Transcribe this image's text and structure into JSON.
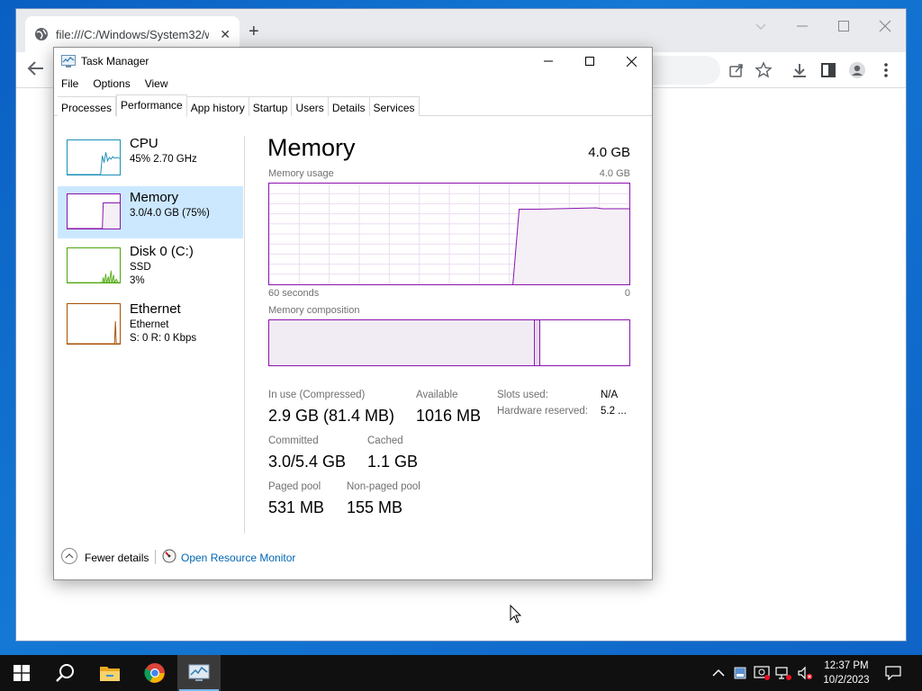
{
  "browser": {
    "tab_title": "file:///C:/Windows/System32/w",
    "new_tab": "+",
    "close_glyph": "✕"
  },
  "task_manager": {
    "title": "Task Manager",
    "menu": [
      "File",
      "Options",
      "View"
    ],
    "tabs": [
      "Processes",
      "Performance",
      "App history",
      "Startup",
      "Users",
      "Details",
      "Services"
    ],
    "active_tab": "Performance",
    "resources": [
      {
        "name": "CPU",
        "line1": "45%  2.70 GHz",
        "line2": "",
        "color": "#1a8fb8"
      },
      {
        "name": "Memory",
        "line1": "3.0/4.0 GB (75%)",
        "line2": "",
        "color": "#8b12ae",
        "selected": true
      },
      {
        "name": "Disk 0 (C:)",
        "line1": "SSD",
        "line2": "3%",
        "color": "#4da60c"
      },
      {
        "name": "Ethernet",
        "line1": "Ethernet",
        "line2": "S: 0  R: 0 Kbps",
        "color": "#a74f01"
      }
    ],
    "memory": {
      "title": "Memory",
      "total": "4.0 GB",
      "usage_label": "Memory usage",
      "usage_max": "4.0 GB",
      "axis_left": "60 seconds",
      "axis_right": "0",
      "composition_label": "Memory composition",
      "stats": {
        "in_use_label": "In use (Compressed)",
        "in_use_value": "2.9 GB (81.4 MB)",
        "available_label": "Available",
        "available_value": "1016 MB",
        "committed_label": "Committed",
        "committed_value": "3.0/5.4 GB",
        "cached_label": "Cached",
        "cached_value": "1.1 GB",
        "paged_label": "Paged pool",
        "paged_value": "531 MB",
        "nonpaged_label": "Non-paged pool",
        "nonpaged_value": "155 MB",
        "slots_label": "Slots used:",
        "slots_value": "N/A",
        "hw_reserved_label": "Hardware reserved:",
        "hw_reserved_value": "5.2 ..."
      }
    },
    "footer": {
      "fewer_details": "Fewer details",
      "open_resource_monitor": "Open Resource Monitor"
    }
  },
  "taskbar": {
    "time": "12:37 PM",
    "date": "10/2/2023"
  },
  "colors": {
    "memory_accent": "#8b12ae",
    "selected_bg": "#cce8ff",
    "link": "#0066b4"
  }
}
